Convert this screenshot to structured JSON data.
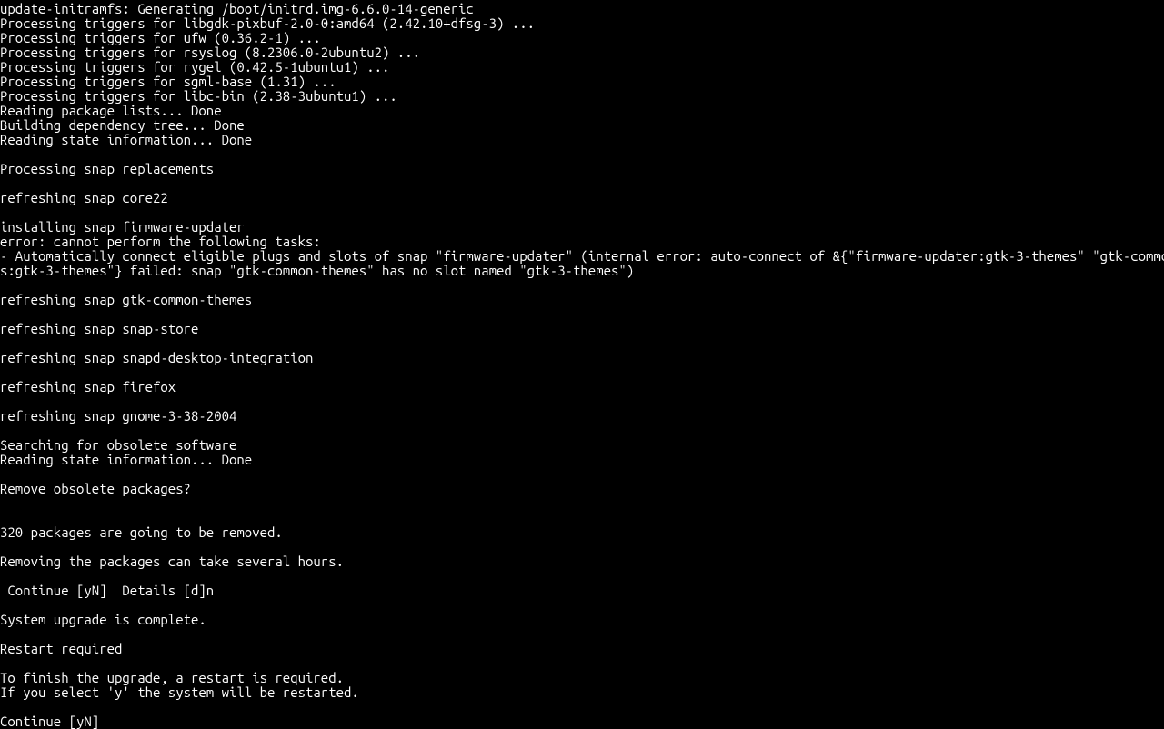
{
  "lines": [
    "update-initramfs: Generating /boot/initrd.img-6.6.0-14-generic",
    "Processing triggers for libgdk-pixbuf-2.0-0:amd64 (2.42.10+dfsg-3) ...",
    "Processing triggers for ufw (0.36.2-1) ...",
    "Processing triggers for rsyslog (8.2306.0-2ubuntu2) ...",
    "Processing triggers for rygel (0.42.5-1ubuntu1) ...",
    "Processing triggers for sgml-base (1.31) ...",
    "Processing triggers for libc-bin (2.38-3ubuntu1) ...",
    "Reading package lists... Done",
    "Building dependency tree... Done",
    "Reading state information... Done",
    "",
    "Processing snap replacements",
    "",
    "refreshing snap core22",
    "",
    "installing snap firmware-updater",
    "error: cannot perform the following tasks:",
    "- Automatically connect eligible plugs and slots of snap \"firmware-updater\" (internal error: auto-connect of &{\"firmware-updater:gtk-3-themes\" \"gtk-common-theme",
    "s:gtk-3-themes\"} failed: snap \"gtk-common-themes\" has no slot named \"gtk-3-themes\")",
    "",
    "refreshing snap gtk-common-themes",
    "",
    "refreshing snap snap-store",
    "",
    "refreshing snap snapd-desktop-integration",
    "",
    "refreshing snap firefox",
    "",
    "refreshing snap gnome-3-38-2004",
    "",
    "Searching for obsolete software",
    "Reading state information... Done",
    "",
    "Remove obsolete packages?",
    "",
    "",
    "320 packages are going to be removed.",
    "",
    "Removing the packages can take several hours.",
    "",
    " Continue [yN]  Details [d]n",
    "",
    "System upgrade is complete.",
    "",
    "Restart required",
    "",
    "To finish the upgrade, a restart is required.",
    "If you select 'y' the system will be restarted.",
    "",
    "Continue [yN]"
  ]
}
